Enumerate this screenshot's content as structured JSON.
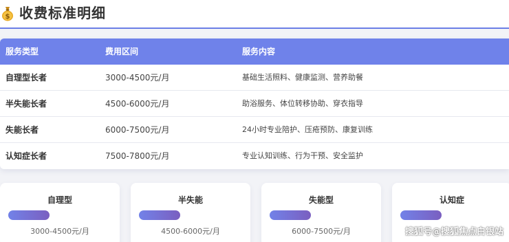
{
  "header": {
    "title": "收费标准明细"
  },
  "table": {
    "columns": [
      "服务类型",
      "费用区间",
      "服务内容"
    ],
    "rows": [
      {
        "type": "自理型长者",
        "range": "3000-4500元/月",
        "content": "基础生活照料、健康监测、营养助餐"
      },
      {
        "type": "半失能长者",
        "range": "4500-6000元/月",
        "content": "助浴服务、体位转移协助、穿衣指导"
      },
      {
        "type": "失能长者",
        "range": "6000-7500元/月",
        "content": "24小时专业陪护、压疮预防、康复训练"
      },
      {
        "type": "认知症长者",
        "range": "7500-7800元/月",
        "content": "专业认知训练、行为干预、安全监护"
      }
    ]
  },
  "cards": [
    {
      "name": "自理型",
      "price": "3000-4500元/月"
    },
    {
      "name": "半失能",
      "price": "4500-6000元/月"
    },
    {
      "name": "失能型",
      "price": "6000-7500元/月"
    },
    {
      "name": "认知症",
      "price": ""
    }
  ],
  "watermark": "搜狐号@搜狐焦点白银站",
  "colors": {
    "accent": "#6f82ea",
    "bar_start": "#7282e8",
    "bar_end": "#7a5fc0"
  },
  "icons": {
    "header": "money-bag-icon"
  }
}
